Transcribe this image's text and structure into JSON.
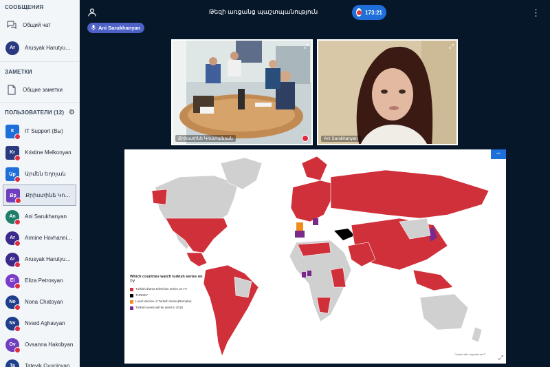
{
  "sidebar": {
    "messages_title": "СООБЩЕНИЯ",
    "public_chat": "Общий чат",
    "dm_user": {
      "initials": "Ar",
      "name": "Arusyak Harutyunyan"
    },
    "notes_title": "ЗАМЕТКИ",
    "shared_notes": "Общие заметки",
    "users_title": "ПОЛЬЗОВАТЕЛИ (12)",
    "users": [
      {
        "initials": "It",
        "name": "IT Support (Вы)",
        "color": "#1e6fd9",
        "shape": "square"
      },
      {
        "initials": "Kr",
        "name": "Kristine Melkonyan",
        "color": "#2b3a80",
        "shape": "square"
      },
      {
        "initials": "Աp",
        "name": "Արմեն Եղոյան",
        "color": "#1e6fd9",
        "shape": "square"
      },
      {
        "initials": "Քp",
        "name": "Քրիստինե Կոստի...",
        "color": "#6f3fc0",
        "shape": "square"
      },
      {
        "initials": "An",
        "name": "Ani Sarukhanyan",
        "color": "#1f7d6b",
        "shape": "circle"
      },
      {
        "initials": "Ar",
        "name": "Armine Hovhannisyan",
        "color": "#3b2a8c",
        "shape": "circle"
      },
      {
        "initials": "Ar",
        "name": "Arusyak Harutyunyan",
        "color": "#3b2a8c",
        "shape": "circle"
      },
      {
        "initials": "El",
        "name": "Eliza Petrosyan",
        "color": "#7a3cc8",
        "shape": "circle"
      },
      {
        "initials": "No",
        "name": "Nona Chatoyan",
        "color": "#1f3f8c",
        "shape": "circle"
      },
      {
        "initials": "Nv",
        "name": "Nvard Aghavyan",
        "color": "#1f3f8c",
        "shape": "circle"
      },
      {
        "initials": "Ov",
        "name": "Ovsanna Hakobyan",
        "color": "#6f3fc0",
        "shape": "circle"
      },
      {
        "initials": "Ta",
        "name": "Tatevik Gyurjinyan",
        "color": "#1f3f8c",
        "shape": "circle"
      }
    ]
  },
  "topbar": {
    "title": "Թեզի առցանց պաշտպանություն",
    "rec_time": "173:21",
    "talking": "Ani Sarukhanyan"
  },
  "videos": [
    {
      "name": "Քրիստինե Կոստանյան"
    },
    {
      "name": "Ani Sarukhanyan"
    }
  ],
  "presentation": {
    "legend_title": "Which countries watch turkish series on TV",
    "legend": [
      {
        "color": "#d0303a",
        "text": "Turkish drama television series on TV"
      },
      {
        "color": "#000000",
        "text": "TURKEY"
      },
      {
        "color": "#f28c1c",
        "text": "Local Version of Turkish Series(Remake)"
      },
      {
        "color": "#7b2a8c",
        "text": "Turkish series will be aired in 2018"
      }
    ],
    "credit": "Created with mapchart.net ©"
  },
  "icons": {
    "chat": "chat-bubbles-icon",
    "notes": "notes-page-icon",
    "settings": "gear-icon",
    "user": "user-icon",
    "menu": "kebab-menu-icon",
    "mic": "microphone-icon"
  }
}
